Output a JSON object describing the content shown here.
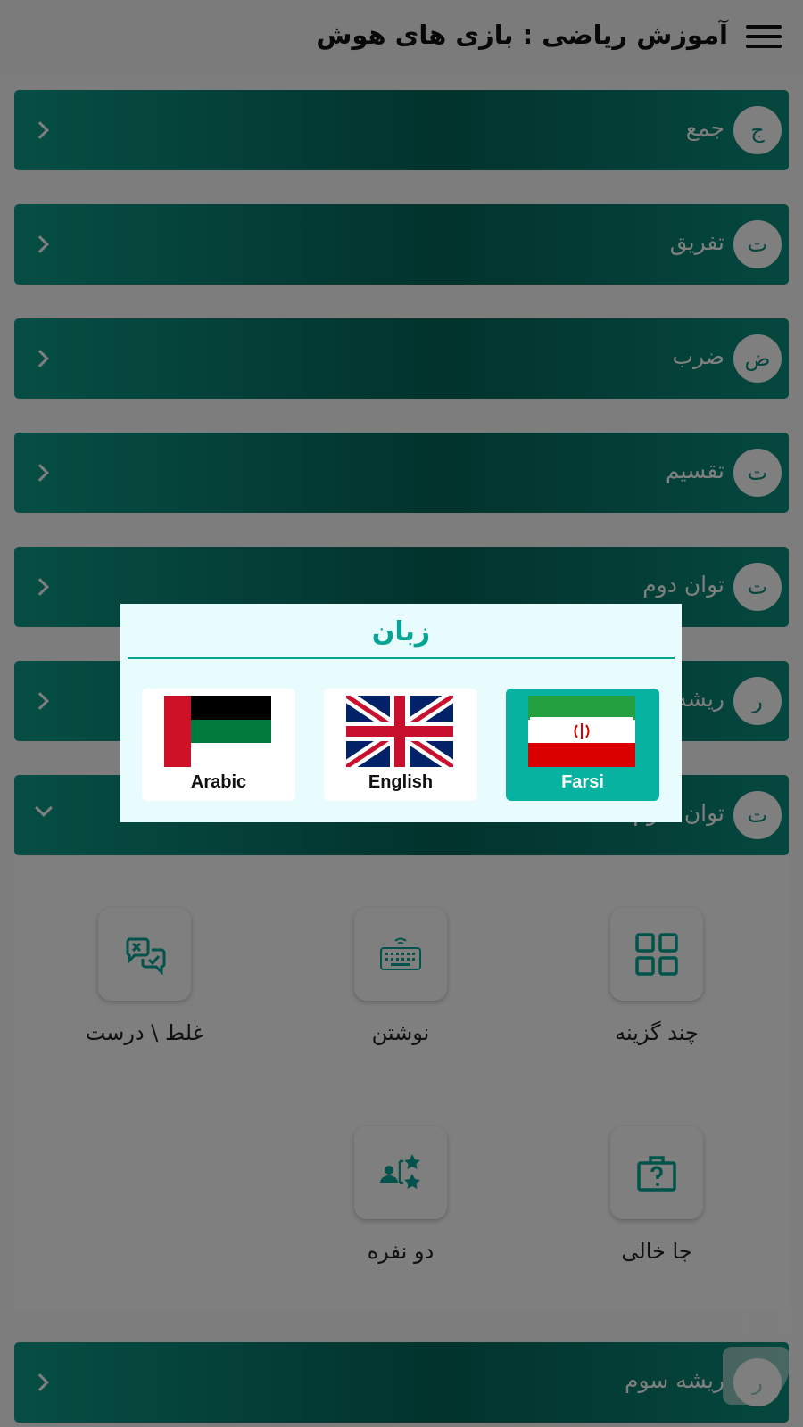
{
  "header": {
    "title": "آموزش ریاضی : بازی های هوش",
    "menu_icon": "hamburger-menu-icon"
  },
  "categories": [
    {
      "letter": "ج",
      "label": "جمع"
    },
    {
      "letter": "ت",
      "label": "تفریق"
    },
    {
      "letter": "ض",
      "label": "ضرب"
    },
    {
      "letter": "ت",
      "label": "تقسیم"
    },
    {
      "letter": "ت",
      "label": "توان دوم"
    },
    {
      "letter": "ر",
      "label": "ریشه دوم"
    },
    {
      "letter": "ت",
      "label": "توان سوم"
    },
    {
      "letter": "ر",
      "label": "ریشه سوم"
    }
  ],
  "modes": [
    {
      "label": "چند گزینه",
      "icon": "grid-icon"
    },
    {
      "label": "نوشتن",
      "icon": "keyboard-icon"
    },
    {
      "label": "غلط \\ درست",
      "icon": "true-false-chat-icon"
    },
    {
      "label": "جا خالی",
      "icon": "question-briefcase-icon"
    },
    {
      "label": "دو نفره",
      "icon": "two-player-stars-icon"
    }
  ],
  "dialog": {
    "title": "زبان",
    "languages": [
      {
        "name": "Farsi",
        "selected": true,
        "flag": "iran-flag-icon"
      },
      {
        "name": "English",
        "selected": false,
        "flag": "uk-flag-icon"
      },
      {
        "name": "Arabic",
        "selected": false,
        "flag": "arab-flag-icon"
      }
    ]
  },
  "colors": {
    "accent": "#07a596",
    "bar_dark": "#04665a",
    "dialog_bg": "#e8fcfd"
  }
}
